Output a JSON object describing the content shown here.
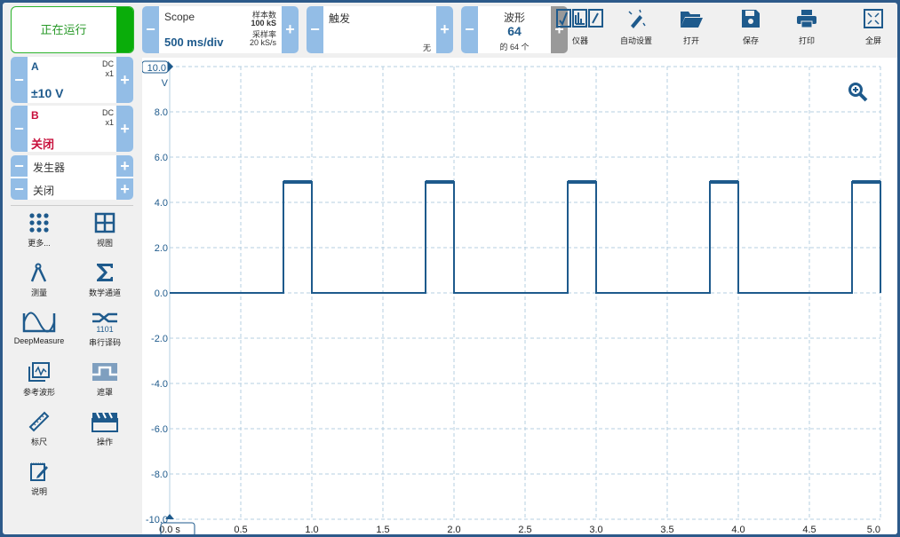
{
  "toolbar": {
    "run_status": "正在运行",
    "timebase": {
      "title": "Scope",
      "value": "500 ms/div",
      "samples_label": "样本数",
      "samples_value": "100 kS",
      "rate_label": "采样率",
      "rate_value": "20 kS/s"
    },
    "trigger": {
      "title": "触发",
      "mode": "无"
    },
    "waveform": {
      "title": "波形",
      "value": "64",
      "of": "的 64 个"
    },
    "buttons": [
      {
        "label": "仪器",
        "icon": "instrument-icon"
      },
      {
        "label": "自动设置",
        "icon": "auto-setup-icon"
      },
      {
        "label": "打开",
        "icon": "folder-open-icon"
      },
      {
        "label": "保存",
        "icon": "save-icon"
      },
      {
        "label": "打印",
        "icon": "print-icon"
      },
      {
        "label": "全屏",
        "icon": "fullscreen-icon"
      }
    ]
  },
  "channels": [
    {
      "name": "A",
      "coupling": "DC",
      "probe": "x1",
      "range": "±10 V",
      "color": "#1e5a8c"
    },
    {
      "name": "B",
      "coupling": "DC",
      "probe": "x1",
      "range": "关闭",
      "color": "#c8103c"
    }
  ],
  "generator": {
    "label": "发生器",
    "state": "关闭"
  },
  "tools": [
    {
      "label": "更多...",
      "icon": "more-icon"
    },
    {
      "label": "视图",
      "icon": "view-grid-icon"
    },
    {
      "label": "测量",
      "icon": "measure-compass-icon"
    },
    {
      "label": "数学通道",
      "icon": "sigma-icon"
    },
    {
      "label": "DeepMeasure",
      "icon": "deepmeasure-icon"
    },
    {
      "label": "串行译码",
      "icon": "serial-decode-icon"
    },
    {
      "label": "参考波形",
      "icon": "reference-waveform-icon"
    },
    {
      "label": "遮罩",
      "icon": "mask-icon"
    },
    {
      "label": "标尺",
      "icon": "ruler-icon"
    },
    {
      "label": "操作",
      "icon": "clapperboard-icon"
    },
    {
      "label": "说明",
      "icon": "notes-icon"
    }
  ],
  "chart_data": {
    "type": "line",
    "xlabel": "s",
    "ylabel": "V",
    "xlim": [
      0,
      5
    ],
    "ylim": [
      -10,
      10
    ],
    "x_ticks": [
      "0.0 s",
      "0.5",
      "1.0",
      "1.5",
      "2.0",
      "2.5",
      "3.0",
      "3.5",
      "4.0",
      "4.5",
      "5.0"
    ],
    "y_ticks": [
      "10.0",
      "8.0",
      "6.0",
      "4.0",
      "2.0",
      "0.0",
      "-2.0",
      "-4.0",
      "-6.0",
      "-8.0",
      "-10.0"
    ],
    "grid": true,
    "series": [
      {
        "name": "A",
        "color": "#1e5a8c",
        "x": [
          0,
          0.8,
          0.8,
          1.0,
          1.0,
          1.8,
          1.8,
          2.0,
          2.0,
          2.8,
          2.8,
          3.0,
          3.0,
          3.8,
          3.8,
          4.0,
          4.0,
          4.8,
          4.8,
          5.0,
          5.0
        ],
        "y": [
          0,
          0,
          4.9,
          4.9,
          0,
          0,
          4.9,
          4.9,
          0,
          0,
          4.9,
          4.9,
          0,
          0,
          4.9,
          4.9,
          0,
          0,
          4.9,
          4.9,
          0
        ]
      }
    ]
  }
}
